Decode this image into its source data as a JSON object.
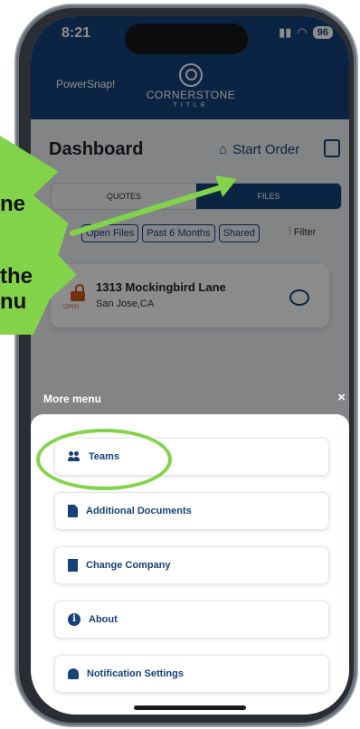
{
  "status": {
    "time": "8:21",
    "battery": "96"
  },
  "header": {
    "left_text": "PowerSnap!",
    "logo_name": "CORNERSTONE",
    "logo_sub": "TITLE"
  },
  "dashboard": {
    "title": "Dashboard",
    "start_order": "Start Order"
  },
  "tabs": [
    {
      "label": "QUOTES"
    },
    {
      "label": "FILES"
    }
  ],
  "filters": {
    "chips": [
      "Open Files",
      "Past 6 Months",
      "Shared"
    ],
    "filter_label": "Filter"
  },
  "file": {
    "title": "1313 Mockingbird Lane",
    "subtitle": "San Jose,CA",
    "status": "OPEN"
  },
  "more_menu": {
    "title": "More menu",
    "close": "×",
    "items": [
      {
        "label": "Teams",
        "icon": "people-icon"
      },
      {
        "label": "Additional Documents",
        "icon": "document-icon"
      },
      {
        "label": "Change Company",
        "icon": "building-icon"
      },
      {
        "label": "About",
        "icon": "info-icon"
      },
      {
        "label": "Notification Settings",
        "icon": "bell-icon"
      }
    ]
  },
  "callout": {
    "lines": [
      "ne",
      "the",
      "nu"
    ]
  },
  "colors": {
    "brand": "#15427a",
    "accent_green": "#83d34a",
    "open_orange": "#d2581f"
  }
}
